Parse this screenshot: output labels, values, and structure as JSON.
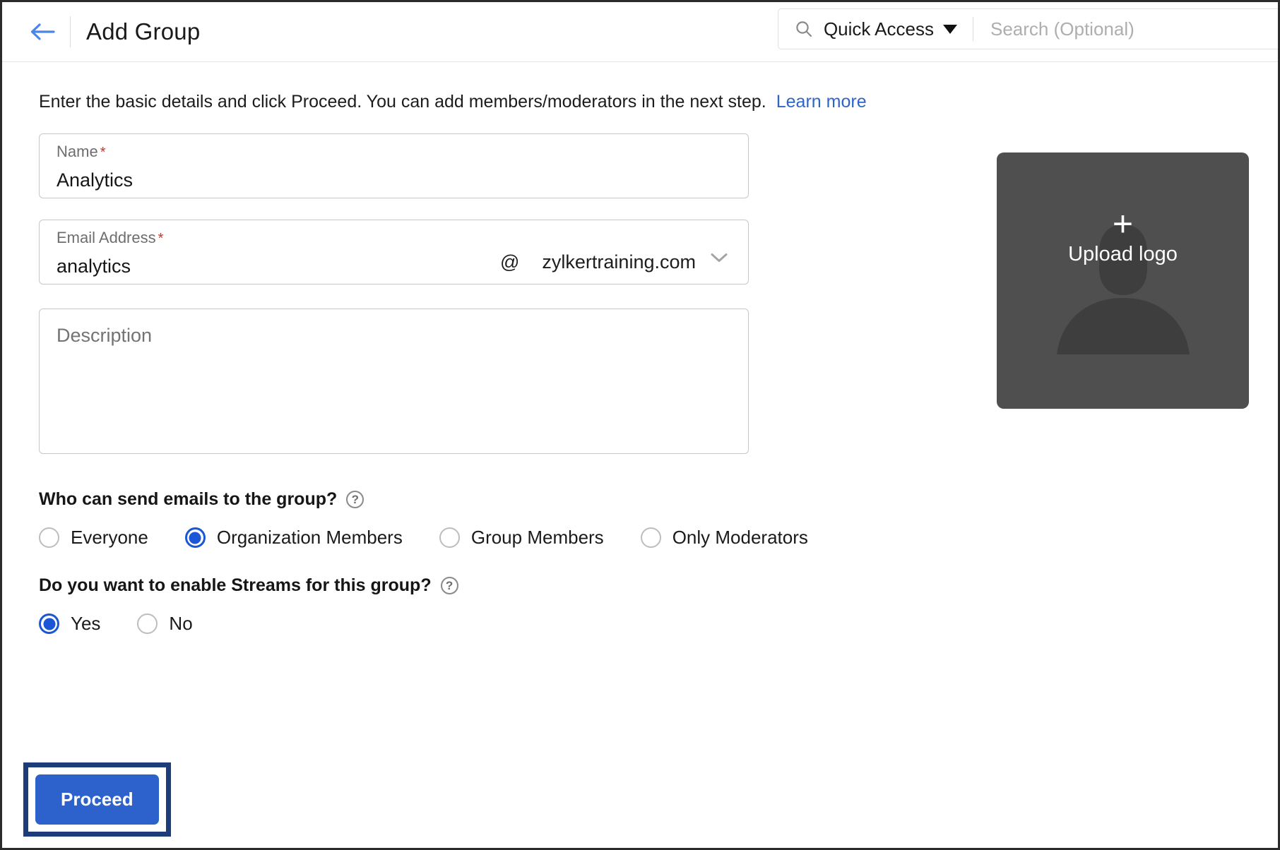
{
  "header": {
    "back_icon": "arrow-left-icon",
    "title": "Add Group",
    "search_icon": "search-icon",
    "quick_access_label": "Quick Access",
    "search_placeholder": "Search (Optional)",
    "search_value": ""
  },
  "intro": {
    "text": "Enter the basic details and click Proceed. You can add members/moderators in the next step.",
    "link_label": "Learn more"
  },
  "form": {
    "name": {
      "label": "Name",
      "required_mark": "*",
      "value": "Analytics",
      "placeholder": "Name"
    },
    "email": {
      "label": "Email Address",
      "required_mark": "*",
      "value": "analytics",
      "placeholder": "Email Address",
      "at_symbol": "@",
      "domain": "zylkertraining.com",
      "chevron_icon": "chevron-down-icon"
    },
    "description": {
      "placeholder": "Description",
      "value": ""
    }
  },
  "questions": [
    {
      "title": "Who can send emails to the group?",
      "help_icon": "help-circle-icon",
      "help_label": "?",
      "options": [
        {
          "label": "Everyone",
          "selected": false
        },
        {
          "label": "Organization Members",
          "selected": true
        },
        {
          "label": "Group Members",
          "selected": false
        },
        {
          "label": "Only Moderators",
          "selected": false
        }
      ]
    },
    {
      "title": "Do you want to enable Streams for this group?",
      "help_icon": "help-circle-icon",
      "help_label": "?",
      "options": [
        {
          "label": "Yes",
          "selected": true
        },
        {
          "label": "No",
          "selected": false
        }
      ]
    }
  ],
  "actions": {
    "proceed_label": "Proceed"
  },
  "logo": {
    "plus_glyph": "+",
    "label": "Upload logo",
    "icon": "user-silhouette-icon"
  },
  "colors": {
    "accent_blue": "#2d62cd",
    "link_blue": "#2f64c8",
    "radio_blue": "#1a56d6",
    "highlight_outline": "#1c3d7a",
    "logo_panel_bg": "#4f4f4f",
    "required_red": "#d93025",
    "back_arrow_blue": "#4a86e8"
  }
}
